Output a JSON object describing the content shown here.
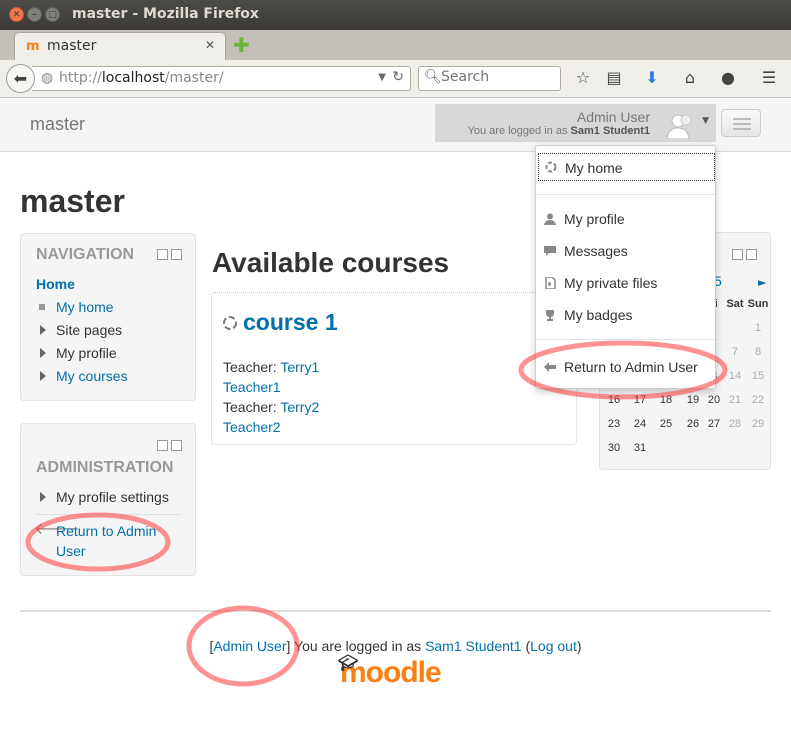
{
  "window": {
    "title": "master - Mozilla Firefox"
  },
  "tab": {
    "title": "master",
    "favicon": "m"
  },
  "navbar": {
    "url_scheme": "http://",
    "url_host": "localhost",
    "url_path": "/master/",
    "search_placeholder": "Search"
  },
  "header": {
    "site_name": "master",
    "user_name": "Admin User",
    "logged_in_prefix": "You are logged in as",
    "logged_in_user": "Sam1 Student1"
  },
  "page": {
    "heading": "master"
  },
  "navigation_block": {
    "title": "NAVIGATION",
    "home": "Home",
    "items": [
      {
        "label": "My home",
        "link": true
      },
      {
        "label": "Site pages",
        "link": false
      },
      {
        "label": "My profile",
        "link": false
      },
      {
        "label": "My courses",
        "link": true
      }
    ]
  },
  "admin_block": {
    "title": "ADMINISTRATION",
    "profile_settings": "My profile settings",
    "return_line1": "Return to Admin",
    "return_line2": "User"
  },
  "main": {
    "available_heading": "Available courses",
    "course": {
      "title": "course 1",
      "teacher_label": "Teacher:",
      "teacher1_first": "Terry1",
      "teacher1_last": "Teacher1",
      "teacher2_first": "Terry2",
      "teacher2_last": "Teacher2"
    }
  },
  "calendar": {
    "month_partial": "5",
    "next_arrow": "►",
    "days": [
      "ri",
      "Sat",
      "Sun"
    ],
    "rows": [
      [
        "",
        "",
        "1"
      ],
      [
        "",
        "7",
        "8"
      ],
      [
        "3",
        "14",
        "15"
      ],
      [
        "19",
        "20",
        "21",
        "22"
      ],
      [
        "23",
        "24",
        "25",
        "26",
        "27",
        "28",
        "29"
      ],
      [
        "30",
        "31"
      ]
    ]
  },
  "dropdown": {
    "items": [
      {
        "label": "My home",
        "icon": "moodle-home-icon"
      },
      {
        "label": "My profile",
        "icon": "user-icon"
      },
      {
        "label": "Messages",
        "icon": "message-icon"
      },
      {
        "label": "My private files",
        "icon": "file-icon"
      },
      {
        "label": "My badges",
        "icon": "trophy-icon"
      },
      {
        "label": "Return to Admin User",
        "icon": "arrow-left-icon"
      }
    ]
  },
  "footer": {
    "admin_link": "Admin User",
    "logged_in_text": "You are logged in as",
    "user_link": "Sam1 Student1",
    "logout_link": "Log out",
    "logo_text": "moodle"
  },
  "colors": {
    "link": "#0070a8",
    "moodle_orange": "#f98012",
    "annotation": "#ff3b3b"
  }
}
